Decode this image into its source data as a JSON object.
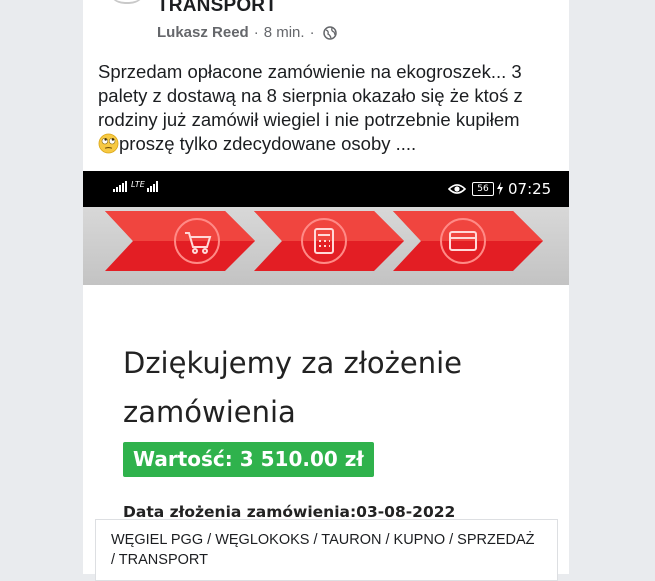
{
  "post": {
    "group_title": "TRANSPORT",
    "author": "Lukasz Reed",
    "separator": "·",
    "time": "8 min.",
    "privacy_icon": "globe-icon",
    "text_main": "Sprzedam opłacone zamówienie na ekogroszek... 3 palety z dostawą na 8 sierpnia okazało się że ktoś z rodziny już zamówił wiegiel i nie potrzebnie kupiłem",
    "emoji_icon": "rolling-eyes-emoji-icon",
    "text_tail": "proszę tylko zdecydowane osoby ...."
  },
  "screenshot": {
    "status_bar": {
      "network": "LTE",
      "battery": "56",
      "time": "07:25",
      "icons": [
        "signal-icon",
        "eye-icon",
        "battery-icon",
        "charging-icon"
      ]
    },
    "banner_icons": [
      "cart-icon",
      "calculator-icon",
      "card-icon"
    ],
    "thanks_title": "Dziękujemy za złożenie zamówienia",
    "value_label": "Wartość: 3 510.00 zł",
    "order_date": "Data złożenia zamówienia:03-08-2022"
  },
  "link_preview": {
    "title": "WĘGIEL PGG / WĘGLOKOKS / TAURON / KUPNO / SPRZEDAŻ / TRANSPORT"
  },
  "colors": {
    "page_bg": "#e9ebee",
    "banner_red": "#e31e24",
    "value_green": "#2fb24c",
    "meta_gray": "#65676b"
  }
}
